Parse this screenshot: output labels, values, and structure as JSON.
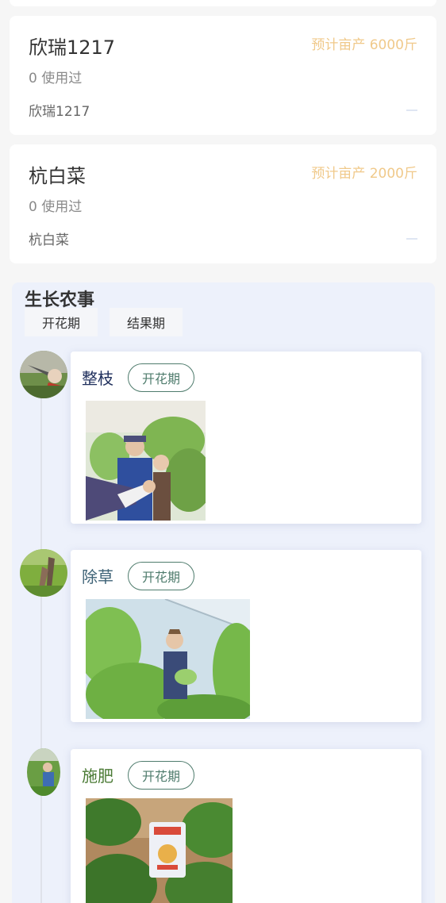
{
  "varieties": [
    {
      "name": "欣瑞1217",
      "yield": "预计亩产 6000斤",
      "used": "0 使用过",
      "sub": "欣瑞1217"
    },
    {
      "name": "杭白菜",
      "yield": "预计亩产 2000斤",
      "used": "0 使用过",
      "sub": "杭白菜"
    }
  ],
  "farm_work": {
    "title": "生长农事",
    "tabs": [
      {
        "label": "开花期"
      },
      {
        "label": "结果期"
      }
    ],
    "events": [
      {
        "name": "整枝",
        "stage": "开花期",
        "name_color": "#1f2f5c",
        "photo_icon": "pruning-photo"
      },
      {
        "name": "除草",
        "stage": "开花期",
        "name_color": "#3d6276",
        "photo_icon": "weeding-photo"
      },
      {
        "name": "施肥",
        "stage": "开花期",
        "name_color": "#4a7a34",
        "photo_icon": "fertilizing-photo"
      }
    ]
  }
}
